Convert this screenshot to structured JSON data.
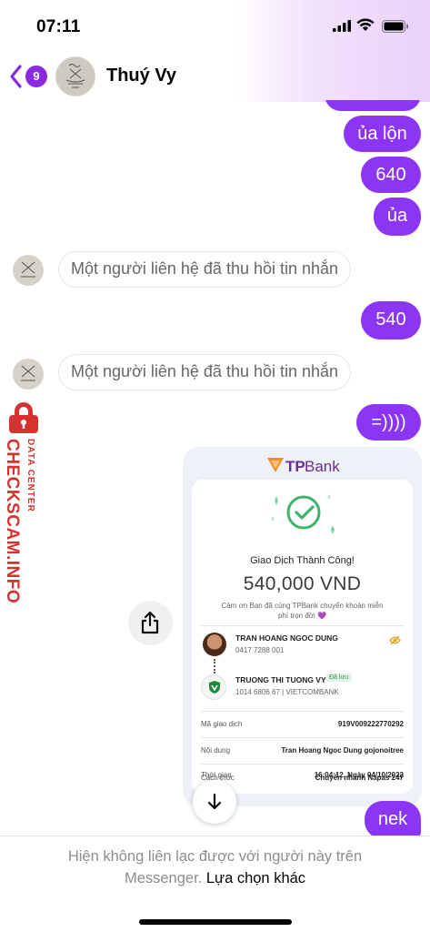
{
  "status_bar": {
    "time": "07:11",
    "signal_icon": "cellular-signal-icon",
    "wifi_icon": "wifi-icon",
    "battery_icon": "battery-icon"
  },
  "header": {
    "back_badge": "9",
    "contact_name": "Thuý Vy",
    "accent": "#8a2be2"
  },
  "messages": {
    "out_1": "ủa lộn",
    "out_2": "640",
    "out_3": "ủa",
    "notice_1": "Một người liên hệ đã thu hồi tin nhắn",
    "out_4": "540",
    "notice_2": "Một người liên hệ đã thu hồi tin nhắn",
    "out_5": "=))))",
    "out_6": "nek",
    "bubble_color": "#8b35f5"
  },
  "receipt": {
    "bank_tp": "TP",
    "bank_name": "Bank",
    "title": "Giao Dịch Thành Công!",
    "amount": "540,000 VND",
    "thanks": "Cảm ơn Bạn đã cùng TPBank chuyển khoản miễn phí trọn đời 💜",
    "sender_name": "TRAN HOANG NGOC DUNG",
    "sender_account": "0417 7288 001",
    "receiver_name": "TRUONG THI TUONG VY",
    "receiver_badge": "Đã lưu",
    "receiver_account": "1014 6806 67 | VIETCOMBANK",
    "rows": [
      {
        "label": "Mã giao dịch",
        "value": "919V009222770292"
      },
      {
        "label": "Nội dung",
        "value": "Tran Hoang Ngoc Dung gojonoitree"
      },
      {
        "label": "Thời gian",
        "value": "16:04:12, Ngày 04/10/2022"
      },
      {
        "label": "Cách thức",
        "value": "Chuyển nhanh Napas 247"
      }
    ]
  },
  "watermark": {
    "big": "CHECKSCAM.INFO",
    "small": "DATA CENTER",
    "color": "#d63330"
  },
  "footer": {
    "text_before": "Hiện không liên lạc được với người này trên Messenger.",
    "link": "Lựa chọn khác"
  }
}
